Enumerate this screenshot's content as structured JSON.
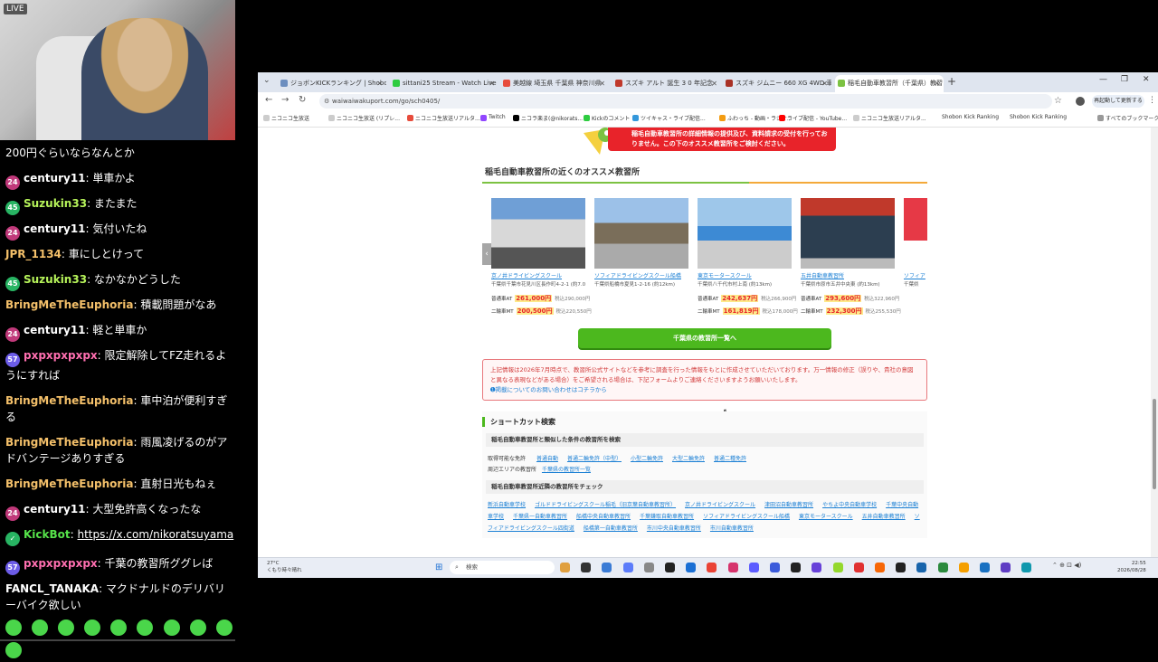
{
  "stream": {
    "cam_tag": "LIVE",
    "chat": [
      {
        "badges": [],
        "user": "",
        "text": "200円ぐらいならなんとか",
        "color": "#ffffff"
      },
      {
        "badges": [
          "24"
        ],
        "user": "century11",
        "text": "単車かよ",
        "color": "#ffffff"
      },
      {
        "badges": [
          "45"
        ],
        "user": "Suzukin33",
        "text": "またまた",
        "color": "#b6f35a"
      },
      {
        "badges": [
          "24"
        ],
        "user": "century11",
        "text": "気付いたね",
        "color": "#ffffff"
      },
      {
        "badges": [],
        "user": "JPR_1134",
        "text": "車にしとけって",
        "color": "#f4c06a"
      },
      {
        "badges": [
          "45"
        ],
        "user": "Suzukin33",
        "text": "なかなかどうした",
        "color": "#b6f35a"
      },
      {
        "badges": [],
        "user": "BringMeTheEuphoria",
        "text": "積載問題がなあ",
        "color": "#f4c06a"
      },
      {
        "badges": [
          "24"
        ],
        "user": "century11",
        "text": "軽と単車か",
        "color": "#ffffff"
      },
      {
        "badges": [
          "57"
        ],
        "user": "pxpxpxpxpx",
        "text": "限定解除してFZ走れるようにすれば",
        "color": "#ff6fb0"
      },
      {
        "badges": [],
        "user": "BringMeTheEuphoria",
        "text": "車中泊が便利すぎる",
        "color": "#f4c06a"
      },
      {
        "badges": [],
        "user": "BringMeTheEuphoria",
        "text": "雨風凌げるのがアドバンテージありすぎる",
        "color": "#f4c06a"
      },
      {
        "badges": [],
        "user": "BringMeTheEuphoria",
        "text": "直射日光もねぇ",
        "color": "#f4c06a"
      },
      {
        "badges": [
          "24"
        ],
        "user": "century11",
        "text": "大型免許高くなったな",
        "color": "#ffffff"
      },
      {
        "badges": [],
        "user": "KickBot",
        "text": "https://x.com/nikoratsuyama",
        "color": "#56e34a"
      },
      {
        "badges": [
          "57"
        ],
        "user": "pxpxpxpxpx",
        "text": "千葉の教習所ググレば",
        "color": "#ff6fb0"
      },
      {
        "badges": [],
        "user": "FANCL_TANAKA",
        "text": "マクドナルドのデリバリーバイク欲しい",
        "color": "#ffffff"
      }
    ]
  },
  "browser": {
    "tabs": [
      {
        "label": "ジョボンKICKランキング | Shobon K",
        "color": "#6c8ebf"
      },
      {
        "label": "sittani25 Stream - Watch Live on",
        "color": "#2ecc40"
      },
      {
        "label": "美越線 埼玉県 千葉県 神奈川県",
        "color": "#e74c3c"
      },
      {
        "label": "スズキ アルト 誕生 3 0 年記念",
        "color": "#c0392b"
      },
      {
        "label": "スズキ ジムニー 660 XG 4WD 車検",
        "color": "#a93226"
      },
      {
        "label": "稲毛自動車教習所（千葉県）教習",
        "color": "#7cc242"
      }
    ],
    "url": "waiwaiwakuport.com/go/sch0405/",
    "relaunch_label": "再起動して更新する",
    "bookmarks": [
      "ニコニコ生放送",
      "ニコニコ生放送 (リプレ...",
      "ニコニコ生放送リアルタ...",
      "Twitch",
      "ニコラ楽ま(@nikorats...",
      "Kickのコメント",
      "ツイキャス・ライブ配信...",
      "ふわっち - 動画・ラジオ...",
      "ライブ配信 - YouTube...",
      "ニコニコ生放送リアルタ...",
      "Shobon Kick Ranking",
      "Shobon Kick Ranking",
      "すべてのブックマーク"
    ]
  },
  "page": {
    "banner_text": "稲毛自動車教習所の詳細情報の提供及び、資料請求の受付を行っておりません。この下のオススメ教習所をご検討ください。",
    "section_title": "稲毛自動車教習所の近くのオススメ教習所",
    "cards": [
      {
        "name": "京ノ井ドライビングスクール",
        "addr": "千葉県千葉市花見川区長作町4-2-1 (約7.0km)",
        "row1_label": "普通車AT",
        "row1_price": "261,000円",
        "row1_tax": "税込290,000円",
        "row2_label": "二輪車MT",
        "row2_price": "200,500円",
        "row2_tax": "税込220,550円"
      },
      {
        "name": "ソフィアドライビングスクール船橋",
        "addr": "千葉県船橋市夏見1-2-16 (約12km)",
        "row1_label": "",
        "row1_price": "",
        "row1_tax": "",
        "row2_label": "",
        "row2_price": "",
        "row2_tax": ""
      },
      {
        "name": "東京モータースクール",
        "addr": "千葉県八千代市村上南 (約13km)",
        "row1_label": "普通車AT",
        "row1_price": "242,637円",
        "row1_tax": "税込266,900円",
        "row2_label": "二輪車MT",
        "row2_price": "161,819円",
        "row2_tax": "税込178,000円"
      },
      {
        "name": "五井自動車教習所",
        "addr": "千葉県市原市五井中央東 (約13km)",
        "row1_label": "普通車AT",
        "row1_price": "293,600円",
        "row1_tax": "税込322,960円",
        "row2_label": "二輪車MT",
        "row2_price": "232,300円",
        "row2_tax": "税込255,530円"
      },
      {
        "name": "ソフィア",
        "addr": "千葉県",
        "row1_label": "",
        "row1_price": "",
        "row1_tax": "",
        "row2_label": "",
        "row2_price": "",
        "row2_tax": ""
      }
    ],
    "list_button": "千葉県の教習所一覧へ",
    "notice_text": "上記情報は2026年7月時点で、教習所公式サイトなどを参考に調査を行った情報をもとに作成させていただいております。万一情報の修正（誤りや、貴社の意図と異なる表現などがある場合）をご希望される場合は、下記フォームよりご連絡くださいますようお願いいたします。",
    "notice_link": "掲載についてのお問い合わせはコチラから",
    "shortcut_title": "ショートカット検索",
    "shortcut_head1": "稲毛自動車教習所と類似した条件の教習所を検索",
    "shortcut_row1_label": "取得可能な免許",
    "shortcut_row1_links": [
      "普通自動",
      "普通二輪免許（中型）",
      "小型二輪免許",
      "大型二輪免許",
      "普通二種免許"
    ],
    "shortcut_row2_label": "周辺エリアの教習所",
    "shortcut_row2_links": [
      "千葉県の教習所一覧"
    ],
    "shortcut_head2": "稲毛自動車教習所近隣の教習所をチェック",
    "nearby_links": [
      "新浜自動車学校",
      "ゴルドドライビングスクール稲毛（旧京葉自動車教習所）",
      "京ノ井ドライビングスクール",
      "津田沼自動車教習所",
      "やちよ中央自動車学校",
      "千葉中央自動車学校",
      "千葉県一自動車教習所",
      "船橋中央自動車教習所",
      "千葉鎌取自動車教習所",
      "ソフィアドライビングスクール船橋",
      "東京モータースクール",
      "五井自動車教習所",
      "ソフィアドライビングスクール四街道",
      "船橋第一自動車教習所",
      "市川中央自動車教習所",
      "市川自動車教習所"
    ]
  },
  "taskbar": {
    "weather_temp": "27°C",
    "weather_desc": "くもり時々晴れ",
    "search_placeholder": "検索",
    "time": "22:55",
    "date": "2026/08/28"
  }
}
